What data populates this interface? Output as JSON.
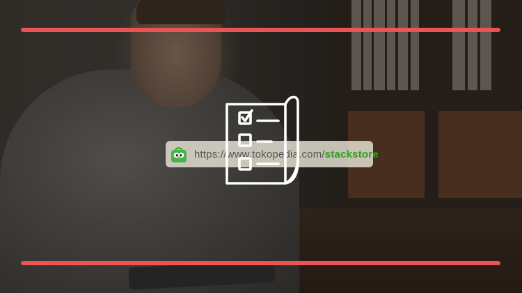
{
  "url": {
    "prefix": "https://www.tokopedia.com/",
    "path": "stackstore"
  },
  "icons": {
    "store": "tokopedia-bag-icon",
    "checklist": "checklist-document-icon"
  },
  "colors": {
    "accent_bar": "#ec5353",
    "url_highlight": "#2e9e24",
    "icon_stroke": "#ffffff"
  }
}
